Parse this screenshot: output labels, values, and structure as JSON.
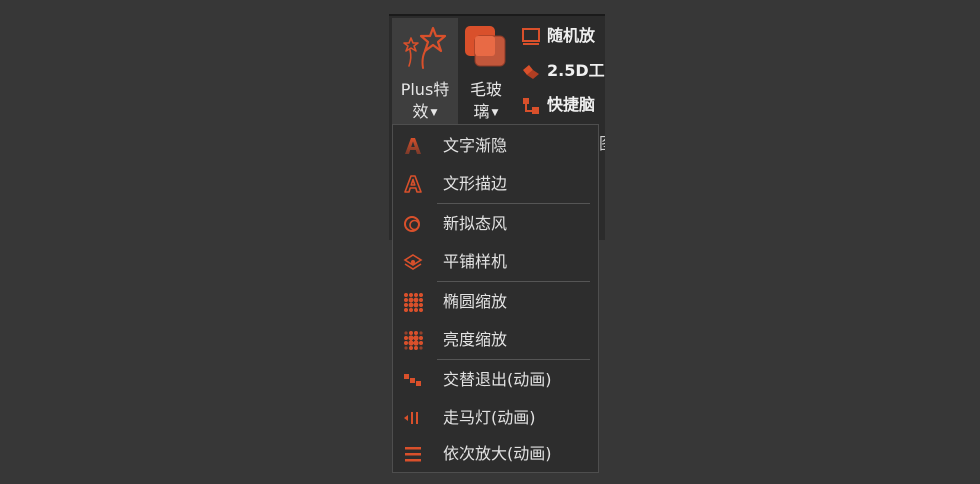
{
  "ribbon": {
    "plus_effects": {
      "line1": "Plus特",
      "line2": "效"
    },
    "frosted_glass": {
      "line1": "毛玻",
      "line2": "璃"
    },
    "small_items": [
      {
        "label": "随机放",
        "icon": "random-icon"
      },
      {
        "label": "2.5D工",
        "icon": "cube-icon"
      },
      {
        "label": "快捷脑",
        "icon": "mindmap-icon"
      }
    ],
    "peek_label": "图"
  },
  "menu": {
    "items": [
      {
        "label": "文字渐隐",
        "icon": "text-fade-icon"
      },
      {
        "label": "文形描边",
        "icon": "text-outline-icon"
      },
      {
        "label": "新拟态风",
        "icon": "neumorphism-icon"
      },
      {
        "label": "平铺样机",
        "icon": "tile-mockup-icon"
      },
      {
        "label": "椭圆缩放",
        "icon": "ellipse-zoom-icon"
      },
      {
        "label": "亮度缩放",
        "icon": "brightness-zoom-icon"
      },
      {
        "label": "交替退出(动画)",
        "icon": "alternate-exit-icon"
      },
      {
        "label": "走马灯(动画)",
        "icon": "marquee-icon"
      },
      {
        "label": "依次放大(动画)",
        "icon": "sequential-zoom-icon"
      }
    ]
  },
  "colors": {
    "accent": "#d9502b",
    "background": "#373737",
    "menu_bg": "#2d2d2d",
    "text": "#e2e2e2"
  }
}
